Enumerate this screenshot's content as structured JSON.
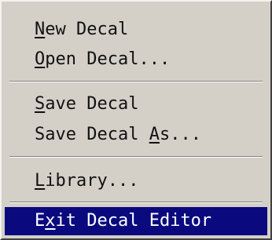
{
  "menu": {
    "items": [
      {
        "pre": "",
        "mnemonic": "N",
        "post": "ew Decal"
      },
      {
        "pre": "",
        "mnemonic": "O",
        "post": "pen Decal..."
      },
      {
        "pre": "",
        "mnemonic": "S",
        "post": "ave Decal"
      },
      {
        "pre": "Save Decal ",
        "mnemonic": "A",
        "post": "s..."
      },
      {
        "pre": "",
        "mnemonic": "L",
        "post": "ibrary..."
      },
      {
        "pre": "E",
        "mnemonic": "x",
        "post": "it Decal Editor"
      }
    ]
  }
}
